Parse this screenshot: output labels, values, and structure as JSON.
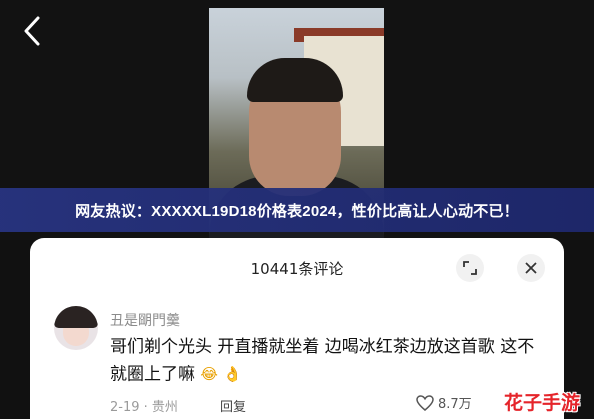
{
  "headline": "网友热议：XXXXXL19D18价格表2024，性价比高让人心动不已！",
  "comments_panel": {
    "title": "10441条评论",
    "comment": {
      "username": "丑是朙門羹",
      "text": "哥们剃个光头 开直播就坐着 边喝冰红茶边放这首歌 这不就圈上了嘛",
      "emojis": [
        "laughing-tears-emoji",
        "ok-hand-emoji"
      ],
      "date_location": "2-19 · 贵州",
      "reply_label": "回复",
      "like_count": "8.7万"
    }
  },
  "watermark": "花子手游",
  "icons": [
    "back-arrow-icon",
    "expand-icon",
    "close-icon",
    "heart-icon"
  ]
}
